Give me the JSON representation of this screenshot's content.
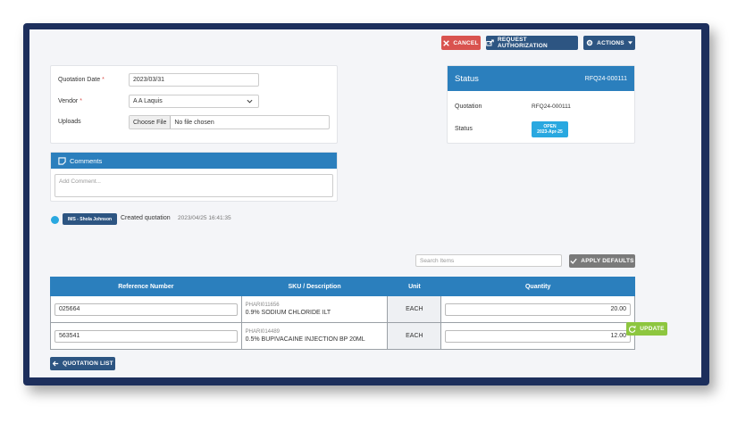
{
  "toolbar": {
    "cancel_label": "CANCEL",
    "request_auth_label": "REQUEST AUTHORIZATION",
    "actions_label": "ACTIONS"
  },
  "form": {
    "quotation_date_label": "Quotation Date",
    "quotation_date_value": "2023/03/31",
    "vendor_label": "Vendor",
    "vendor_value": "A A Laquis",
    "uploads_label": "Uploads",
    "choose_file_label": "Choose File",
    "no_file_text": "No file chosen",
    "required_marker": "*"
  },
  "comments": {
    "title": "Comments",
    "placeholder": "Add Comment..."
  },
  "status_panel": {
    "title": "Status",
    "code": "RFQ24-000111",
    "quotation_label": "Quotation",
    "quotation_value": "RFQ24-000111",
    "status_label": "Status",
    "badge_line1": "OPEN",
    "badge_line2": "2023-Apr-25"
  },
  "activity": {
    "user": "IMS - Shola Johnson",
    "action": "Created quotation",
    "timestamp": "2023/04/25 16:41:35"
  },
  "items_search": {
    "placeholder": "Search Items",
    "apply_defaults_label": "APPLY DEFAULTS"
  },
  "table": {
    "headers": [
      "Reference Number",
      "SKU / Description",
      "Unit",
      "Quantity"
    ],
    "rows": [
      {
        "ref": "025664",
        "sku": "PHARI011656",
        "desc": "0.9% SODIUM CHLORIDE ILT",
        "unit": "EACH",
        "qty": "20.00"
      },
      {
        "ref": "563541",
        "sku": "PHARI014489",
        "desc": "0.5% BUPIVACAINE INJECTION BP 20ML",
        "unit": "EACH",
        "qty": "12.00"
      }
    ]
  },
  "footer": {
    "quotation_list_label": "QUOTATION LIST",
    "update_label": "UPDATE"
  },
  "colors": {
    "primary": "#2b7fbd",
    "dark_button": "#2d5582",
    "danger": "#d9534f",
    "success": "#8dc63f",
    "info": "#29a8e0"
  }
}
